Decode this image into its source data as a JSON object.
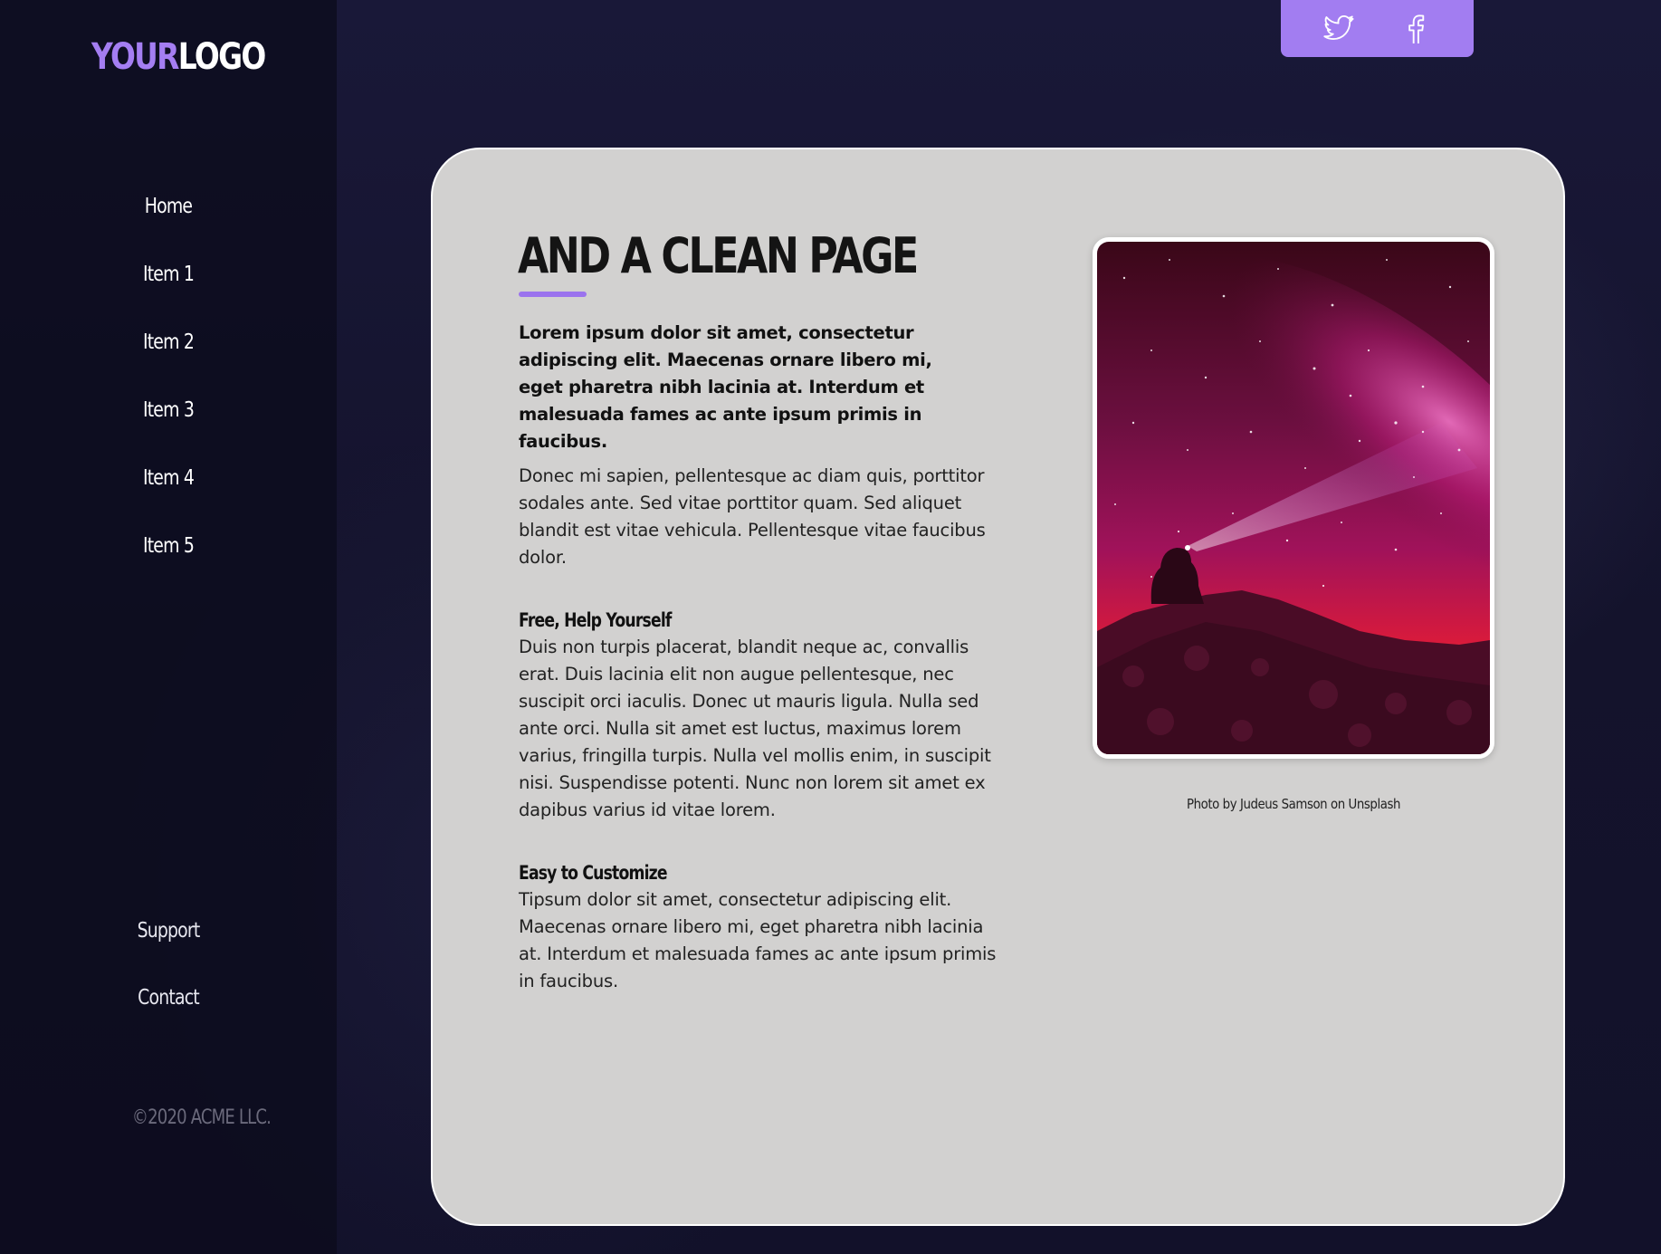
{
  "logo": {
    "part1": "YOUR",
    "part2": "LOGO"
  },
  "nav": {
    "items": [
      {
        "label": "Home"
      },
      {
        "label": "Item 1"
      },
      {
        "label": "Item 2"
      },
      {
        "label": "Item 3"
      },
      {
        "label": "Item 4"
      },
      {
        "label": "Item 5"
      }
    ],
    "secondary": [
      {
        "label": "Support"
      },
      {
        "label": "Contact"
      }
    ]
  },
  "footer": {
    "copyright": "©2020 ACME LLC."
  },
  "social": {
    "icons": [
      "twitter-icon",
      "facebook-icon"
    ]
  },
  "colors": {
    "accent": "#a27df1",
    "card": "#d2d1d0",
    "sidebar": "#0c0c1c"
  },
  "content": {
    "title": "AND A CLEAN PAGE",
    "lead": "Lorem ipsum dolor sit amet, consectetur adipiscing elit. Maecenas ornare libero mi, eget pharetra nibh lacinia at. Interdum et malesuada fames ac ante ipsum primis in faucibus.",
    "para1": "Donec mi sapien, pellentesque ac diam quis, porttitor sodales ante. Sed vitae porttitor quam. Sed aliquet blandit est vitae vehicula. Pellentesque vitae faucibus dolor.",
    "section1": {
      "heading": "Free, Help Yourself",
      "body": "Duis non turpis placerat, blandit neque ac, convallis erat. Duis lacinia elit non augue pellentesque, nec suscipit orci iaculis. Donec ut mauris ligula. Nulla sed ante orci. Nulla sit amet est luctus, maximus lorem varius, fringilla turpis. Nulla vel mollis enim, in suscipit nisi. Suspendisse potenti. Nunc non lorem sit amet ex dapibus varius id vitae lorem."
    },
    "section2": {
      "heading": "Easy to Customize",
      "body": "Tipsum dolor sit amet, consectetur adipiscing elit. Maecenas ornare libero mi, eget pharetra nibh lacinia at. Interdum et malesuada fames ac ante ipsum primis in faucibus."
    },
    "photo_caption": "Photo by Judeus Samson on Unsplash"
  }
}
